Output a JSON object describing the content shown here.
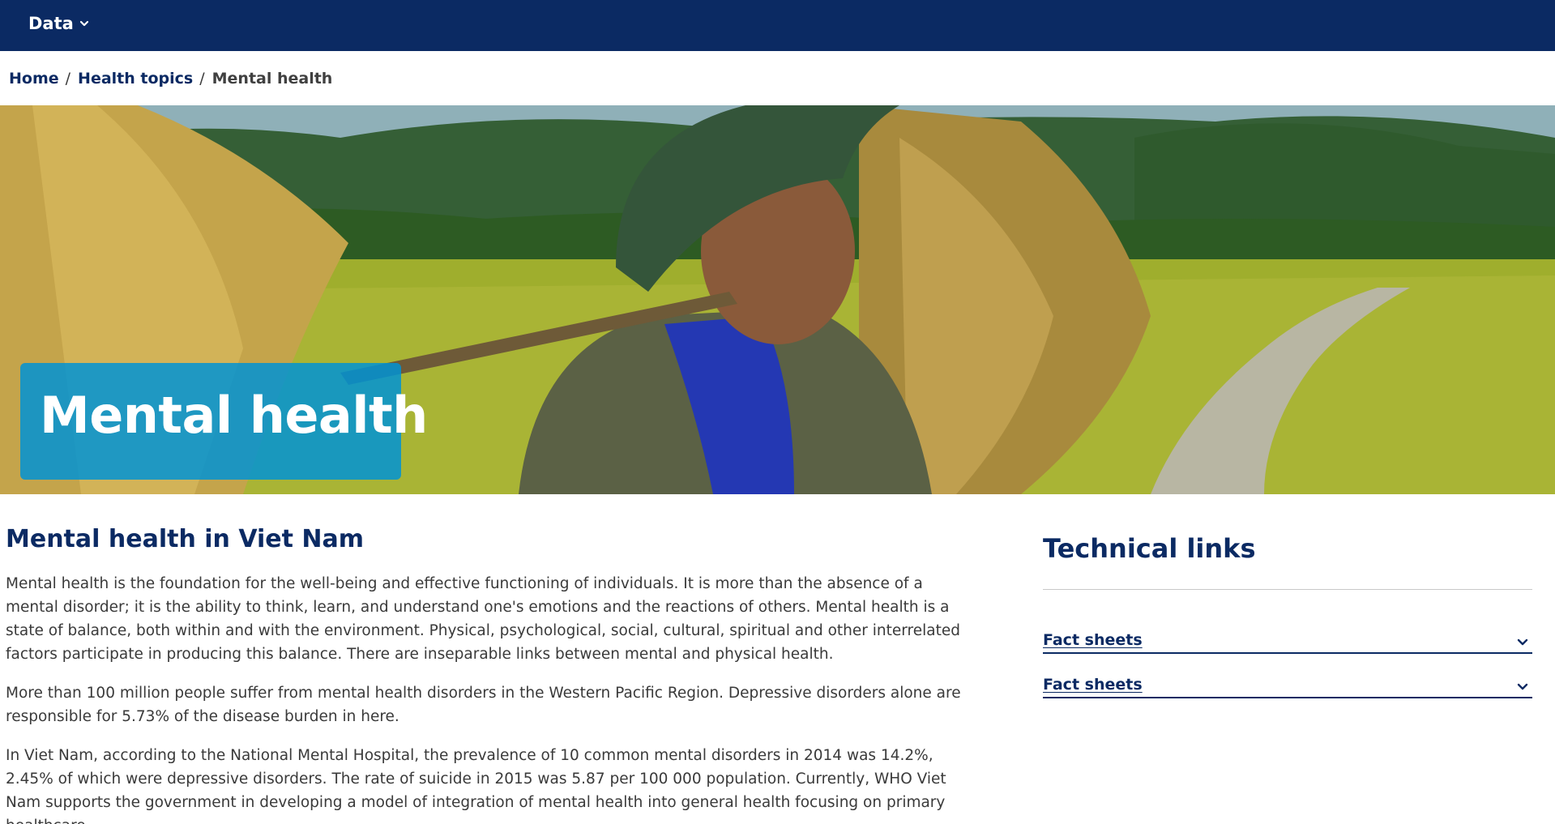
{
  "nav": {
    "menu_label": "Data",
    "menu_icon": "chevron-down-icon",
    "bar_color": "#0b2a63"
  },
  "breadcrumb": {
    "items": [
      "Home",
      "Health topics",
      "Mental health"
    ],
    "separator": "/"
  },
  "hero": {
    "title": "Mental health",
    "title_box_color": "#0093d5"
  },
  "main": {
    "heading": "Mental health in Viet Nam",
    "paragraphs": [
      "Mental health is the foundation for the well-being and effective functioning of individuals. It is more than the absence of a mental disorder; it is the ability to think, learn, and understand one's emotions and the reactions of others. Mental health is a state of balance, both within and with the environment. Physical, psychological, social, cultural, spiritual and other interrelated factors participate in producing this balance. There are inseparable links between mental and physical health.",
      "More than 100 million people suffer from mental health disorders in the Western Pacific Region. Depressive disorders alone are responsible for 5.73% of the disease burden in here.",
      "In Viet Nam, according to the National Mental Hospital, the prevalence of 10 common mental disorders in 2014 was 14.2%, 2.45% of which were depressive disorders. The rate of suicide in 2015 was 5.87 per 100 000 population. Currently, WHO Viet Nam supports the government in developing a model of integration of mental health into general health focusing on primary healthcare."
    ]
  },
  "sidebar": {
    "heading": "Technical links",
    "accordions": [
      {
        "label": "Fact sheets",
        "icon": "chevron-down-icon"
      },
      {
        "label": "Fact sheets",
        "icon": "chevron-down-icon"
      }
    ]
  }
}
